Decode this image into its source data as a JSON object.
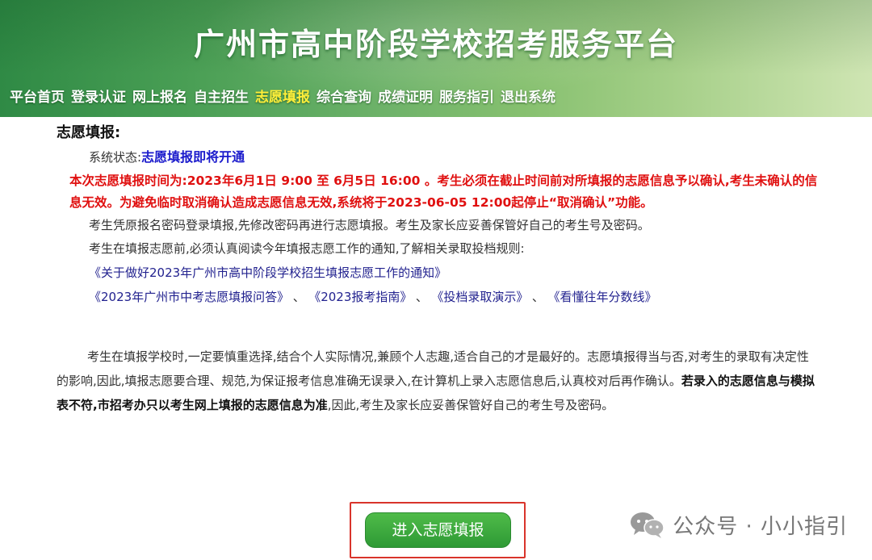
{
  "site": {
    "title": "广州市高中阶段学校招考服务平台"
  },
  "nav": {
    "items": [
      {
        "label": "平台首页"
      },
      {
        "label": "登录认证"
      },
      {
        "label": "网上报名"
      },
      {
        "label": "自主招生"
      },
      {
        "label": "志愿填报",
        "active": true
      },
      {
        "label": "综合查询"
      },
      {
        "label": "成绩证明"
      },
      {
        "label": "服务指引"
      },
      {
        "label": "退出系统"
      }
    ]
  },
  "main": {
    "section_title": "志愿填报:",
    "status_label": "系统状态:",
    "status_value": "志愿填报即将开通",
    "notice": "本次志愿填报时间为:2023年6月1日 9:00 至 6月5日 16:00 。考生必须在截止时间前对所填报的志愿信息予以确认,考生未确认的信息无效。为避免临时取消确认造成志愿信息无效,系统将于2023-06-05 12:00起停止“取消确认”功能。",
    "para1": "考生凭原报名密码登录填报,先修改密码再进行志愿填报。考生及家长应妥善保管好自己的考生号及密码。",
    "para2": "考生在填报志愿前,必须认真阅读今年填报志愿工作的通知,了解相关录取投档规则:",
    "links": {
      "notice_link": "《关于做好2023年广州市高中阶段学校招生填报志愿工作的通知》",
      "faq_link": "《2023年广州市中考志愿填报问答》",
      "guide_link": "《2023报考指南》",
      "demo_link": "《投档录取演示》",
      "scores_link": "《看懂往年分数线》",
      "separator": "、"
    },
    "body_text_normal": "考生在填报学校时,一定要慎重选择,结合个人实际情况,兼顾个人志趣,适合自己的才是最好的。志愿填报得当与否,对考生的录取有决定性的影响,因此,填报志愿要合理、规范,为保证报考信息准确无误录入,在计算机上录入志愿信息后,认真校对后再作确认。",
    "body_text_bold": "若录入的志愿信息与模拟表不符,市招考办只以考生网上填报的志愿信息为准",
    "body_text_end": ",因此,考生及家长应妥善保管好自己的考生号及密码。",
    "enter_button": "进入志愿填报"
  },
  "watermark": {
    "text": "公众号 · 小小指引",
    "icon": "wechat-icon"
  },
  "colors": {
    "banner_green": "#4a9f55",
    "active_nav": "#ffef3a",
    "notice_red": "#e01010",
    "status_blue": "#1a1acc",
    "link_blue": "#22228f",
    "button_green": "#3aa83c",
    "highlight_box": "#d9342b"
  }
}
